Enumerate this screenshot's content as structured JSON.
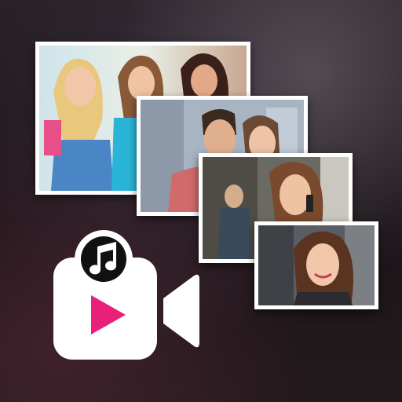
{
  "app": {
    "icon_name": "video-maker-with-music-icon"
  },
  "collage": {
    "photos": [
      {
        "id": "photo-1",
        "subject": "three-friends-shopping"
      },
      {
        "id": "photo-2",
        "subject": "couple-portrait"
      },
      {
        "id": "photo-3",
        "subject": "woman-on-phone"
      },
      {
        "id": "photo-4",
        "subject": "woman-smiling-portrait"
      }
    ]
  },
  "camera_badge": {
    "icon": "video-camera-icon",
    "play_icon": "play-icon",
    "music_icon": "music-note-icon"
  },
  "colors": {
    "accent": "#e8207a",
    "frame": "#ffffff",
    "background": "#1c1619"
  }
}
